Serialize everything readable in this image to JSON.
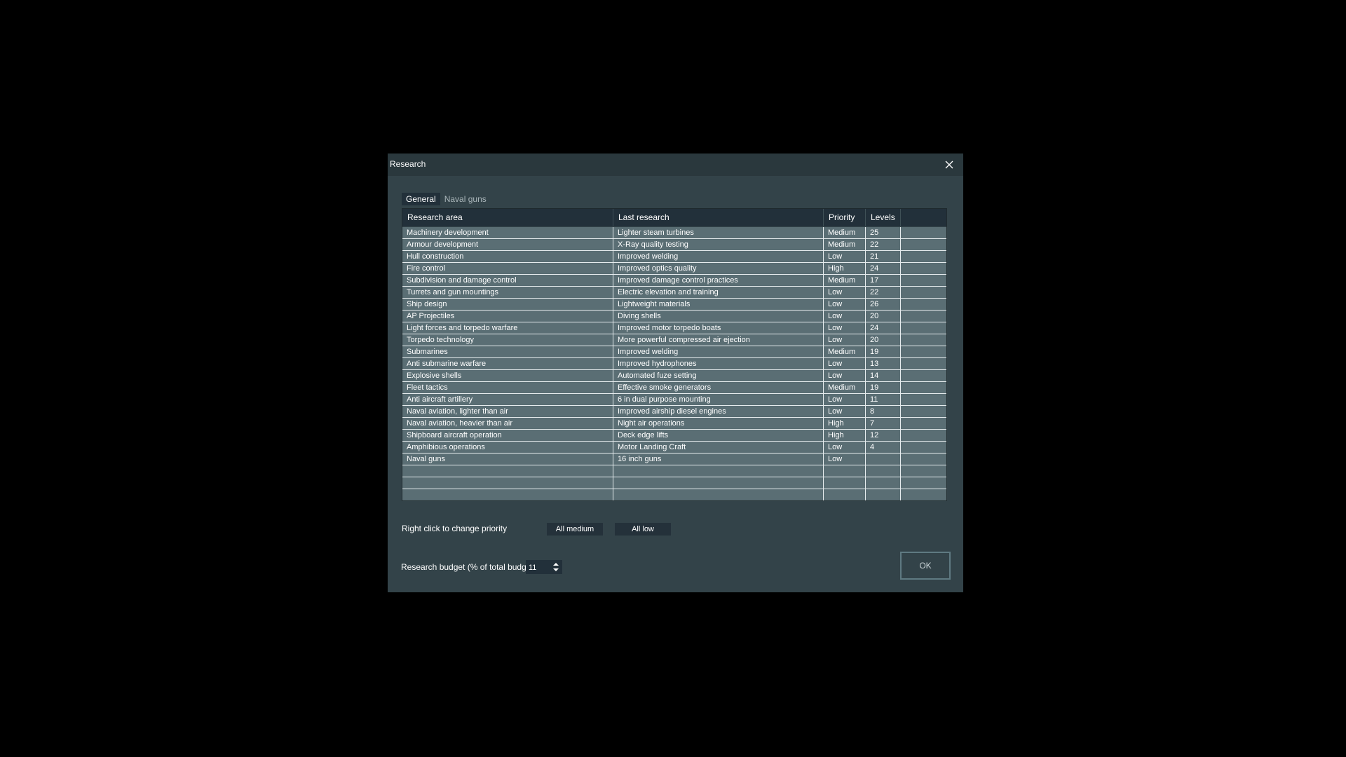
{
  "window": {
    "title": "Research"
  },
  "icons": {
    "close": "close-icon",
    "spin": "spin-arrows-icon"
  },
  "tabs": [
    {
      "label": "General",
      "active": true
    },
    {
      "label": "Naval guns",
      "active": false
    }
  ],
  "table": {
    "headers": [
      "Research area",
      "Last research",
      "Priority",
      "Levels"
    ],
    "rows": [
      [
        "Machinery development",
        "Lighter steam turbines",
        "Medium",
        "25"
      ],
      [
        "Armour development",
        "X-Ray quality testing",
        "Medium",
        "22"
      ],
      [
        "Hull construction",
        "Improved welding",
        "Low",
        "21"
      ],
      [
        "Fire control",
        "Improved optics quality",
        "High",
        "24"
      ],
      [
        "Subdivision and damage control",
        "Improved damage control practices",
        "Medium",
        "17"
      ],
      [
        "Turrets and gun mountings",
        "Electric elevation and training",
        "Low",
        "22"
      ],
      [
        "Ship design",
        "Lightweight materials",
        "Low",
        "26"
      ],
      [
        "AP Projectiles",
        "Diving shells",
        "Low",
        "20"
      ],
      [
        "Light forces and torpedo warfare",
        "Improved motor torpedo boats",
        "Low",
        "24"
      ],
      [
        "Torpedo technology",
        "More powerful compressed air ejection",
        "Low",
        "20"
      ],
      [
        "Submarines",
        "Improved welding",
        "Medium",
        "19"
      ],
      [
        "Anti submarine warfare",
        "Improved hydrophones",
        "Low",
        "13"
      ],
      [
        "Explosive shells",
        "Automated fuze setting",
        "Low",
        "14"
      ],
      [
        "Fleet tactics",
        "Effective smoke generators",
        "Medium",
        "19"
      ],
      [
        "Anti aircraft artillery",
        "6 in dual purpose mounting",
        "Low",
        "11"
      ],
      [
        "Naval aviation, lighter than air",
        "Improved airship diesel engines",
        "Low",
        "8"
      ],
      [
        "Naval aviation, heavier than air",
        "Night air operations",
        "High",
        "7"
      ],
      [
        "Shipboard aircraft operation",
        "Deck edge lifts",
        "High",
        "12"
      ],
      [
        "Amphibious operations",
        "Motor Landing Craft",
        "Low",
        "4"
      ],
      [
        "Naval guns",
        "16 inch guns",
        "Low",
        ""
      ]
    ]
  },
  "footer": {
    "hint": "Right click to change priority",
    "all_medium": "All medium",
    "all_low": "All low",
    "budget_label": "Research budget (% of total budget)",
    "budget_value": "11",
    "ok": "OK"
  },
  "colors": {
    "dialog_bg": "#334349",
    "titlebar_bg": "#2a383d",
    "header_bg": "#22303a",
    "row_bg": "#5a6e74",
    "grid_line": "#e6ecee"
  }
}
